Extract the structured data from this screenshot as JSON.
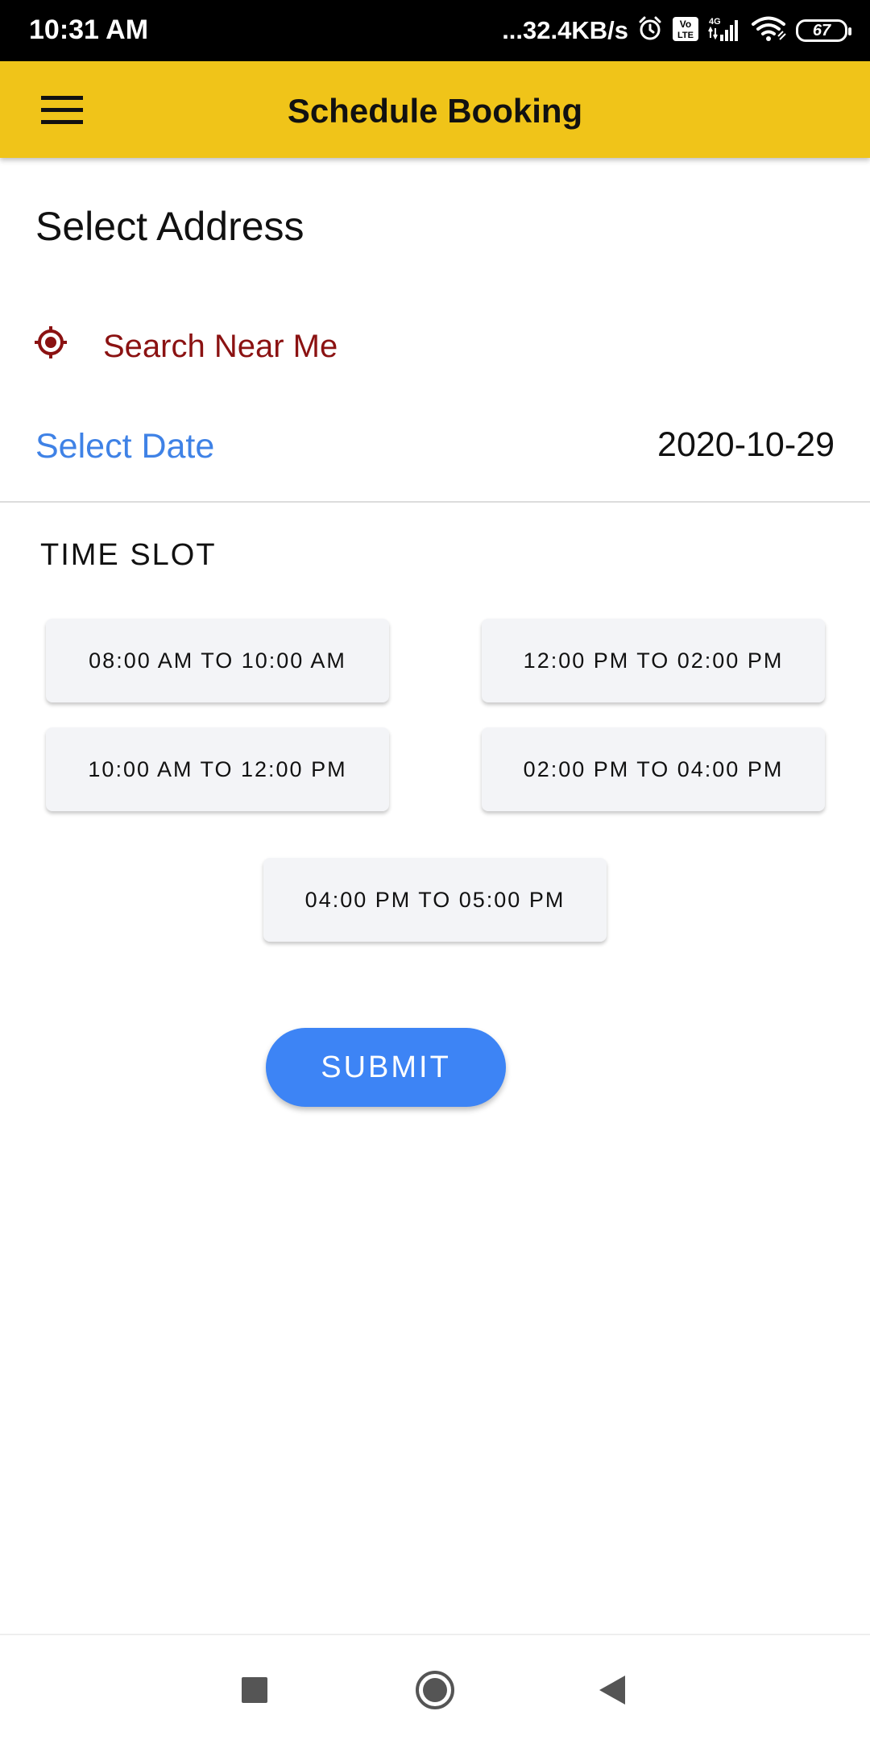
{
  "status_bar": {
    "time": "10:31 AM",
    "network_speed": "...32.4KB/s",
    "battery_level": "67",
    "icons": [
      "alarm-icon",
      "volte-icon",
      "signal-4g-icon",
      "wifi-icon",
      "battery-icon"
    ]
  },
  "app_bar": {
    "title": "Schedule Booking",
    "menu_icon": "hamburger-menu-icon"
  },
  "address": {
    "title": "Select Address",
    "search_near_me": "Search Near Me"
  },
  "date": {
    "label": "Select Date",
    "value": "2020-10-29"
  },
  "time_slot": {
    "title": "TIME SLOT",
    "slots": [
      "08:00 AM TO 10:00 AM",
      "12:00 PM TO 02:00 PM",
      "10:00 AM TO 12:00 PM",
      "02:00 PM TO 04:00 PM",
      "04:00 PM TO 05:00 PM"
    ]
  },
  "submit_label": "SUBMIT",
  "colors": {
    "app_bar": "#f0c419",
    "search_near_me": "#8b1212",
    "date_label": "#3f82e6",
    "submit": "#3d84f5",
    "slot_bg": "#f3f4f7"
  },
  "nav_bar": {
    "icons": [
      "recent-apps-icon",
      "home-icon",
      "back-icon"
    ]
  }
}
